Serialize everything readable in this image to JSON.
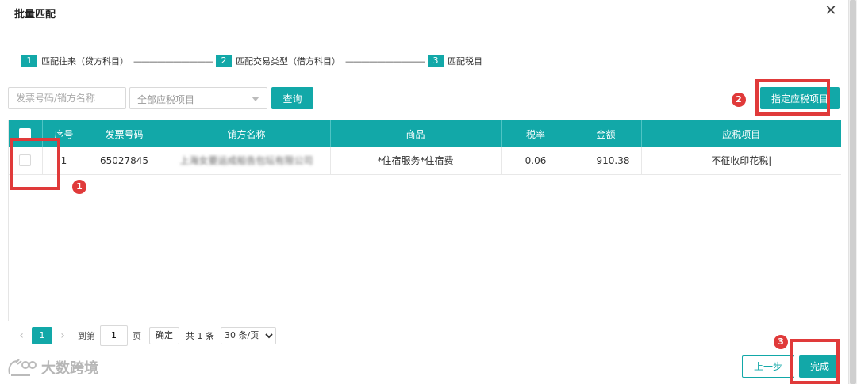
{
  "dialog": {
    "title": "批量匹配",
    "close_glyph": "✕"
  },
  "steps": [
    {
      "num": "1",
      "label": "匹配往来（贷方科目）",
      "line": "——————————"
    },
    {
      "num": "2",
      "label": "匹配交易类型（借方科目）",
      "line": "——————————"
    },
    {
      "num": "3",
      "label": "匹配税目"
    }
  ],
  "filters": {
    "search_placeholder": "发票号码/销方名称",
    "select_placeholder": "全部应税项目",
    "query_button": "查询",
    "assign_button": "指定应税项目"
  },
  "table": {
    "columns": [
      "",
      "序号",
      "发票号码",
      "销方名称",
      "商品",
      "税率",
      "金额",
      "应税项目"
    ],
    "rows": [
      {
        "index": "1",
        "invoice_no": "65027845",
        "seller": "上海女要运成船告包坛有限公司",
        "goods": "*住宿服务*住宿费",
        "tax_rate": "0.06",
        "amount": "910.38",
        "tax_item": "不征收印花税|"
      }
    ]
  },
  "pagination": {
    "prev": "‹",
    "current": "1",
    "next": "›",
    "goto_label": "到第",
    "goto_value": "1",
    "page_unit": "页",
    "confirm": "确定",
    "total": "共 1 条",
    "page_size": "30 条/页"
  },
  "footer": {
    "prev_step": "上一步",
    "finish": "完成"
  },
  "watermark": {
    "text": "大数跨境"
  },
  "annotations": {
    "badge_1": "1",
    "badge_2": "2",
    "badge_3": "3",
    "color": "#e03a3a"
  },
  "colors": {
    "accent": "#12a8a8"
  }
}
